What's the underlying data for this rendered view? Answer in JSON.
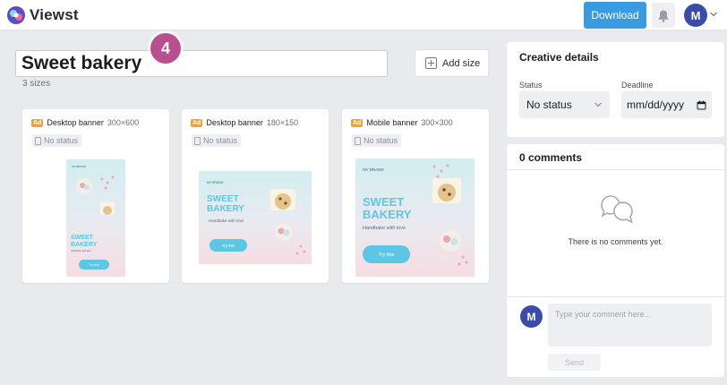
{
  "app": {
    "name": "Viewst",
    "user_initial": "M"
  },
  "toolbar": {
    "download_label": "Download"
  },
  "project": {
    "title": "Sweet bakery",
    "sizes_count": "3 sizes",
    "step_badge": "4",
    "add_size_label": "Add size"
  },
  "cards": [
    {
      "tag": "Ad",
      "name": "Desktop banner",
      "size": "300×600",
      "status": "No status",
      "thumb": {
        "brand": "MY BRAND",
        "headline1": "SWEET",
        "headline2": "BAKERY",
        "sub": "Handbake with love",
        "cta": "Try this"
      }
    },
    {
      "tag": "Ad",
      "name": "Desktop banner",
      "size": "180×150",
      "status": "No status",
      "thumb": {
        "brand": "MY BRAND",
        "headline1": "SWEET",
        "headline2": "BAKERY",
        "sub": "Handbake with love",
        "cta": "Try this"
      }
    },
    {
      "tag": "Ad",
      "name": "Mobile banner",
      "size": "300×300",
      "status": "No status",
      "thumb": {
        "brand": "MY BRAND",
        "headline1": "SWEET",
        "headline2": "BAKERY",
        "sub": "Handbake with love",
        "cta": "Try this"
      }
    }
  ],
  "details": {
    "title": "Creative details",
    "status_label": "Status",
    "status_value": "No status",
    "deadline_label": "Deadline",
    "deadline_placeholder": "mm/dd/yyyy"
  },
  "comments": {
    "title": "0 comments",
    "empty_text": "There is no comments yet.",
    "input_placeholder": "Type your comment here...",
    "send_label": "Send"
  },
  "colors": {
    "accent": "#3b9be0",
    "badge": "#b94f8f",
    "avatar": "#3b4ca8",
    "ad_tag": "#f0a23a",
    "banner_teal": "#5cc6e4"
  },
  "icons": {
    "logo": "viewst-logo-icon",
    "bell": "bell-icon",
    "chevron": "chevron-down-icon",
    "plus": "plus-square-icon",
    "clipboard": "clipboard-icon",
    "calendar": "calendar-icon",
    "comments": "speech-bubbles-icon"
  }
}
